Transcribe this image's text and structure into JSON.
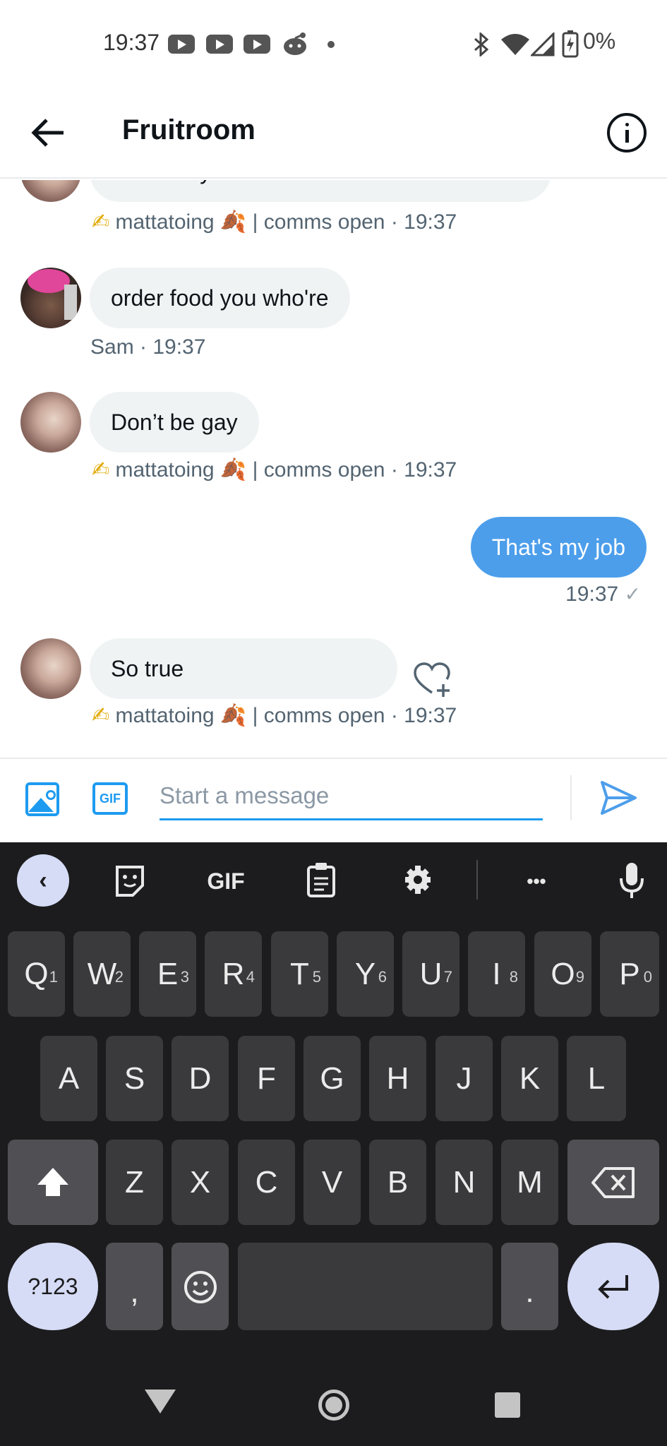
{
  "status_bar": {
    "time": "19:37",
    "notification_icons": [
      "youtube-icon",
      "youtube-icon",
      "youtube-icon",
      "reddit-icon",
      "dot-icon"
    ],
    "right_icons": [
      "bluetooth-icon",
      "wifi-icon",
      "signal-icon",
      "battery-icon"
    ],
    "battery": "0%"
  },
  "header": {
    "title": "Fruitroom",
    "back_icon": "back-arrow-icon",
    "info_icon": "info-icon"
  },
  "conversation": {
    "partial_top_text": "Takeaway wouldn't be warm either lol",
    "partial_top_meta": {
      "pen": "✍",
      "name": "mattatoing",
      "leaf": "🍂",
      "suffix": "| comms open · 19:37"
    },
    "messages": [
      {
        "sender": "Sam",
        "text": "order food you who're",
        "meta": "Sam · 19:37"
      },
      {
        "sender": "mattatoing",
        "text": "Don’t be gay",
        "meta": {
          "pen": "✍",
          "name": "mattatoing",
          "leaf": "🍂",
          "suffix": "| comms open · 19:37"
        }
      },
      {
        "sender": "me",
        "text": "That's my job",
        "meta": "19:37",
        "status": "✓"
      },
      {
        "sender": "mattatoing",
        "text": "So true",
        "meta": {
          "pen": "✍",
          "name": "mattatoing",
          "leaf": "🍂",
          "suffix": "| comms open · 19:37"
        },
        "reaction_icon": "heart-plus-icon"
      }
    ]
  },
  "composer": {
    "placeholder": "Start a message",
    "image_icon": "image-icon",
    "gif_label": "GIF",
    "send_icon": "send-icon"
  },
  "keyboard": {
    "toolbar": {
      "collapse": "‹",
      "gif": "GIF",
      "more": "•••",
      "icons": [
        "chevron-left-icon",
        "sticker-icon",
        "gif-icon",
        "clipboard-icon",
        "settings-icon",
        "more-icon",
        "mic-icon"
      ]
    },
    "row1": [
      {
        "key": "Q",
        "hint": "1"
      },
      {
        "key": "W",
        "hint": "2"
      },
      {
        "key": "E",
        "hint": "3"
      },
      {
        "key": "R",
        "hint": "4"
      },
      {
        "key": "T",
        "hint": "5"
      },
      {
        "key": "Y",
        "hint": "6"
      },
      {
        "key": "U",
        "hint": "7"
      },
      {
        "key": "I",
        "hint": "8"
      },
      {
        "key": "O",
        "hint": "9"
      },
      {
        "key": "P",
        "hint": "0"
      }
    ],
    "row2": [
      "A",
      "S",
      "D",
      "F",
      "G",
      "H",
      "J",
      "K",
      "L"
    ],
    "row3": [
      "Z",
      "X",
      "C",
      "V",
      "B",
      "N",
      "M"
    ],
    "row4": {
      "symbols": "?123",
      "comma": ",",
      "period": "."
    }
  },
  "nav_bar": {
    "icons": [
      "nav-back-icon",
      "nav-home-icon",
      "nav-recents-icon"
    ]
  }
}
